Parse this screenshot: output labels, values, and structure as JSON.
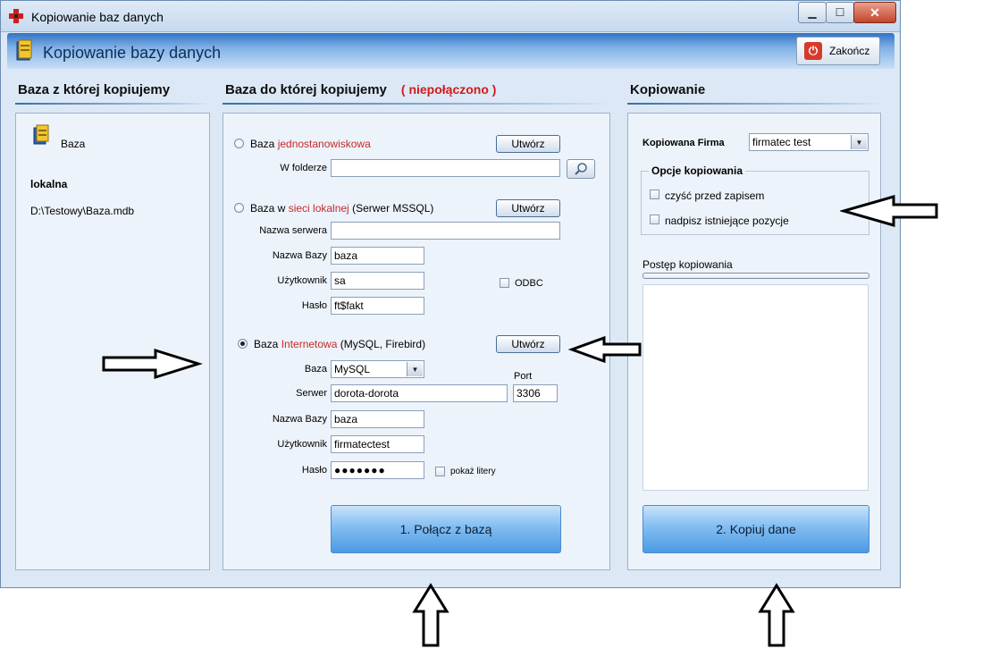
{
  "window": {
    "title": "Kopiowanie baz danych",
    "header_title": "Kopiowanie bazy danych",
    "exit_label": "Zakończ",
    "btn_min": "▁",
    "btn_max": "☐",
    "btn_close": "✕"
  },
  "source": {
    "heading": "Baza z której kopiujemy",
    "db_label": "Baza",
    "type": "lokalna",
    "path": "D:\\Testowy\\Baza.mdb"
  },
  "target": {
    "heading": "Baza do której kopiujemy",
    "status": "( niepołączono )",
    "single": {
      "label_prefix": "Baza ",
      "label_red": "jednostanowiskowa",
      "create_label": "Utwórz",
      "folder_label": "W folderze",
      "folder_value": ""
    },
    "lan": {
      "label_prefix": "Baza w ",
      "label_red": "sieci lokalnej",
      "label_suffix": " (Serwer MSSQL)",
      "create_label": "Utwórz",
      "server_label": "Nazwa serwera",
      "server_value": "",
      "dbname_label": "Nazwa Bazy",
      "dbname_value": "baza",
      "user_label": "Użytkownik",
      "user_value": "sa",
      "password_label": "Hasło",
      "password_value": "ft$fakt",
      "odbc_label": "ODBC"
    },
    "internet": {
      "label_prefix": "Baza ",
      "label_red": "Internetowa",
      "label_suffix": "  (MySQL, Firebird)",
      "create_label": "Utwórz",
      "db_label": "Baza",
      "db_value": "MySQL",
      "port_label": "Port",
      "port_value": "3306",
      "server_label": "Serwer",
      "server_value": "dorota-dorota",
      "dbname_label": "Nazwa Bazy",
      "dbname_value": "baza",
      "user_label": "Użytkownik",
      "user_value": "firmatectest",
      "password_label": "Hasło",
      "password_value": "●●●●●●●",
      "show_chars_label": "pokaż litery"
    },
    "connect_label": "1. Połącz z bazą"
  },
  "copy": {
    "heading": "Kopiowanie",
    "company_label": "Kopiowana Firma",
    "company_value": "firmatec test",
    "options_legend": "Opcje kopiowania",
    "opt_clear": "czyść przed zapisem",
    "opt_overwrite": "nadpisz istniejące pozycje",
    "progress_label": "Postęp kopiowania",
    "progress": 0,
    "copy_label": "2. Kopiuj dane"
  }
}
